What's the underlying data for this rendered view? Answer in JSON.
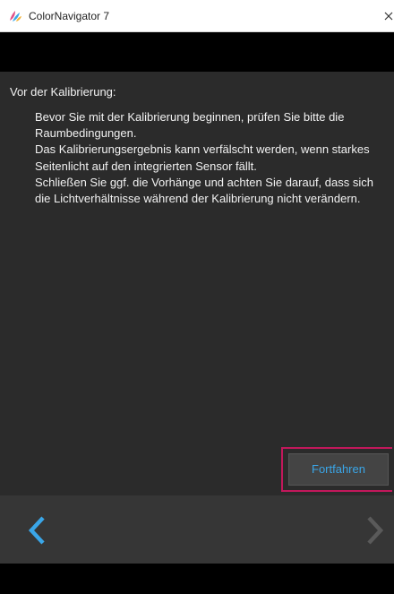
{
  "window": {
    "title": "ColorNavigator 7",
    "app_icon": "colornavigator-logo-icon",
    "close_icon": "close-icon"
  },
  "content": {
    "heading": "Vor der Kalibrierung:",
    "paragraphs": [
      "Bevor Sie mit der Kalibrierung beginnen, prüfen Sie bitte die Raumbedingungen.",
      "Das Kalibrierungsergebnis kann verfälscht werden, wenn starkes Seitenlicht auf den integrierten Sensor fällt.",
      "Schließen Sie ggf. die Vorhänge und achten Sie darauf, dass sich die Lichtverhältnisse während der Kalibrierung nicht verändern."
    ]
  },
  "actions": {
    "continue_label": "Fortfahren",
    "highlight_color": "#c2185b",
    "label_color": "#3aa6e8"
  },
  "navigation": {
    "back_icon": "chevron-left-icon",
    "forward_icon": "chevron-right-icon",
    "back_enabled": true,
    "forward_enabled": false
  }
}
